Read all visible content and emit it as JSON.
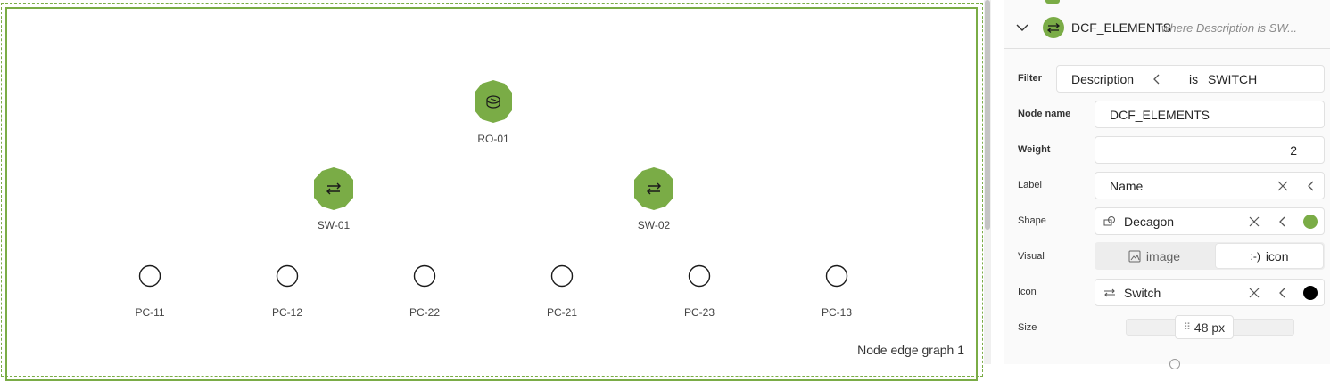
{
  "graph": {
    "title": "Node edge graph 1",
    "nodes": {
      "ro01": "RO-01",
      "sw01": "SW-01",
      "sw02": "SW-02",
      "pc11": "PC-11",
      "pc12": "PC-12",
      "pc22": "PC-22",
      "pc21": "PC-21",
      "pc23": "PC-23",
      "pc13": "PC-13"
    },
    "node_color": "#7aac46"
  },
  "panel": {
    "header": {
      "title": "DCF_ELEMENTS",
      "subtitle": "where Description is SW..."
    },
    "filter": {
      "label": "Filter",
      "field": "Description",
      "operator": "is",
      "value": "SWITCH"
    },
    "node_name": {
      "label": "Node name",
      "value": "DCF_ELEMENTS"
    },
    "weight": {
      "label": "Weight",
      "value": "2"
    },
    "label_row": {
      "label": "Label",
      "value": "Name"
    },
    "shape": {
      "label": "Shape",
      "value": "Decagon",
      "color": "#7aac46"
    },
    "visual": {
      "label": "Visual",
      "option_image": "image",
      "option_icon": "icon",
      "icon_glyph": ":-)"
    },
    "icon": {
      "label": "Icon",
      "value": "Switch",
      "color": "#000000"
    },
    "size": {
      "label": "Size",
      "value": "48 px"
    }
  }
}
